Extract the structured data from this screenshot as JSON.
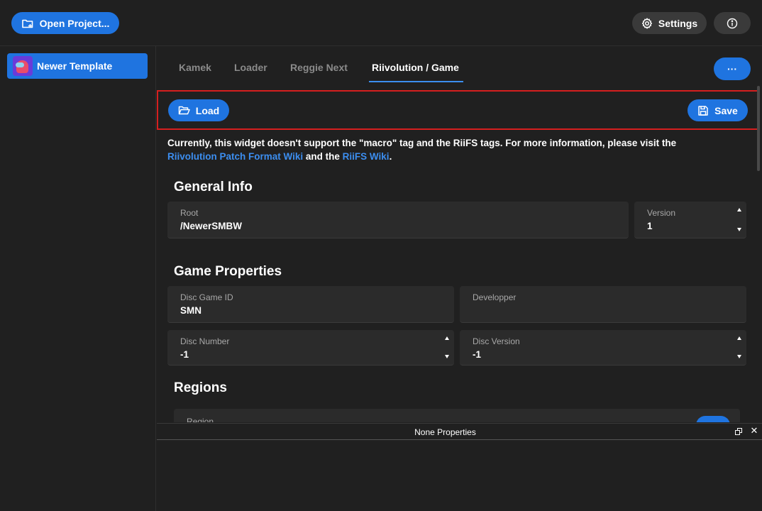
{
  "topbar": {
    "open_project_label": "Open Project...",
    "settings_label": "Settings"
  },
  "sidebar": {
    "items": [
      {
        "label": "Newer Template",
        "selected": true
      }
    ]
  },
  "tabs": [
    {
      "label": "Kamek",
      "active": false
    },
    {
      "label": "Loader",
      "active": false
    },
    {
      "label": "Reggie Next",
      "active": false
    },
    {
      "label": "Riivolution / Game",
      "active": true
    }
  ],
  "more_label": "···",
  "toolbar": {
    "load_label": "Load",
    "save_label": "Save"
  },
  "notice": {
    "text_1": "Currently, this widget doesn't support the \"macro\" tag and the RiiFS tags. For more information, please visit the",
    "link_1": "Riivolution Patch Format Wiki",
    "text_2": " and the ",
    "link_2": "RiiFS Wiki",
    "text_3": "."
  },
  "general_info": {
    "title": "General Info",
    "root_label": "Root",
    "root_value": "/NewerSMBW",
    "version_label": "Version",
    "version_value": "1"
  },
  "game_properties": {
    "title": "Game Properties",
    "disc_game_id_label": "Disc Game ID",
    "disc_game_id_value": "SMN",
    "developper_label": "Developper",
    "developper_value": "",
    "disc_number_label": "Disc Number",
    "disc_number_value": "-1",
    "disc_version_label": "Disc Version",
    "disc_version_value": "-1"
  },
  "regions": {
    "title": "Regions",
    "partial_label": "Region"
  },
  "bottom_panel": {
    "title": "None Properties",
    "close_glyph": "✕"
  },
  "colors": {
    "accent": "#1f74e0",
    "link": "#3c8ef0",
    "background": "#202020",
    "field": "#2b2b2b",
    "highlight_border": "#d51f1f"
  },
  "icons": {
    "open_project": "folder-plus-icon",
    "settings": "gear-icon",
    "info": "info-circle-icon",
    "load": "folder-open-icon",
    "save": "floppy-disk-icon",
    "float": "float-window-icon",
    "close": "close-icon"
  }
}
